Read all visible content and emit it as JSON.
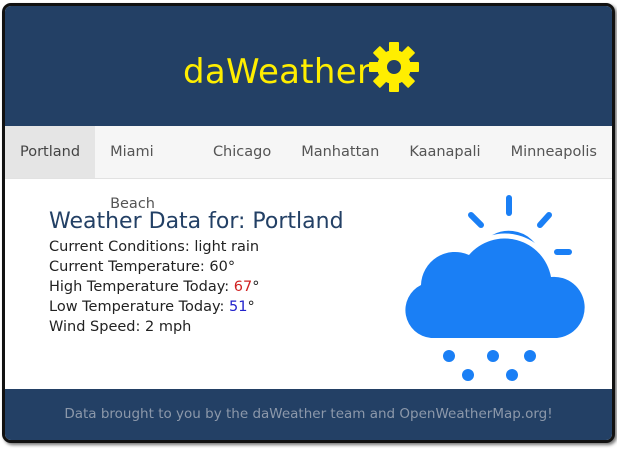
{
  "header": {
    "title": "daWeather",
    "logo_icon": "gear-icon",
    "brand_color": "#ffee00",
    "background": "#234065"
  },
  "nav": {
    "tabs": [
      {
        "label": "Portland",
        "active": true
      },
      {
        "label": "Miami Beach",
        "active": false
      },
      {
        "label": "Chicago",
        "active": false
      },
      {
        "label": "Manhattan",
        "active": false
      },
      {
        "label": "Kaanapali",
        "active": false
      },
      {
        "label": "Minneapolis",
        "active": false
      }
    ]
  },
  "weather": {
    "title": "Weather Data for: Portland",
    "conditions_label": "Current Conditions: ",
    "conditions": "light rain",
    "current_temp_label": "Current Temperature: ",
    "current_temp": "60",
    "high_label": "High Temperature Today: ",
    "high": "67",
    "low_label": "Low Temperature Today: ",
    "low": "51",
    "degree": "°",
    "wind_label": "Wind Speed: ",
    "wind": "2 mph",
    "icon": "sun-cloud-rain-icon",
    "icon_color": "#1a7ff5",
    "high_color": "#d02222",
    "low_color": "#2222cc"
  },
  "footer": {
    "text": "Data brought to you by the daWeather team and OpenWeatherMap.org!"
  }
}
